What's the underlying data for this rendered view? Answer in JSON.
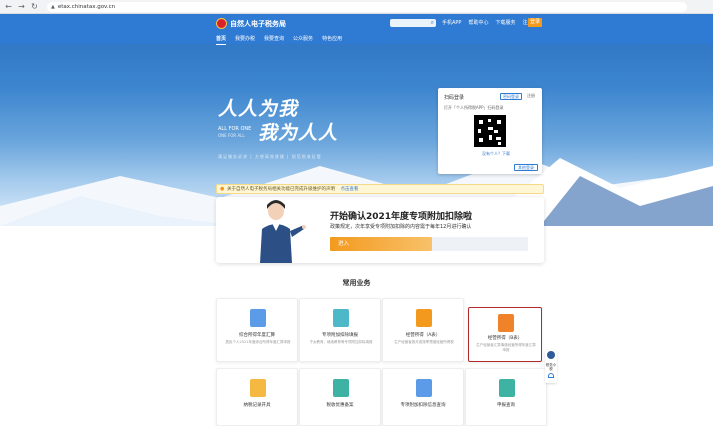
{
  "browser": {
    "url": "etax.chinatax.gov.cn"
  },
  "header": {
    "site_name": "自然人电子税务局",
    "links": [
      "手机APP",
      "帮助中心",
      "下载服务",
      "注册"
    ],
    "login_label": "登录",
    "menu": [
      "首页",
      "我要办税",
      "我要查询",
      "公众服务",
      "特色应用"
    ]
  },
  "hero": {
    "slogan1": "人人为我",
    "slogan2": "我为人人",
    "slogan_en": "ALL FOR ONE",
    "slogan_en_sub": "ONE FOR ALL",
    "tagline": "满足服务诉求 | 方便高效便捷 | 规范税收征管"
  },
  "qr_login": {
    "title": "扫码登录",
    "tab_active": "密码登录",
    "tab_other": "注册",
    "hint": "打开「个人所得税APP」扫码登录",
    "download": "没有个人？下载",
    "other_login": "其他登录"
  },
  "notice": {
    "text": "关于自然人电子税务局相关功能已完成升级维护的声明",
    "more": "点击查看"
  },
  "banner": {
    "heading": "开始确认2021年度专项附加扣除啦",
    "text": "政策规定，次年享受专项附加扣除的内容需于每年12月进行确认",
    "enter_label": "进入"
  },
  "section_title": "常用业务",
  "cards": [
    {
      "title": "综合所得年度汇算",
      "desc": "居民个人2021年度综合所得年度汇算申报",
      "icon": "tax-return-icon",
      "color": "#5b9be8"
    },
    {
      "title": "专项附加扣除填报",
      "desc": "子女教育、继续教育等专项附加扣除填报",
      "icon": "deduction-form-icon",
      "color": "#4db8c7"
    },
    {
      "title": "经营所得（A表）",
      "desc": "生产经营者按月或按季预缴经营所得税",
      "icon": "business-income-a-icon",
      "color": "#f39a1e"
    },
    {
      "title": "经营所得（B表）",
      "desc": "生产经营者汇算清缴经营所得年度汇算申报",
      "icon": "business-income-b-icon",
      "color": "#f0832a"
    }
  ],
  "cards_row2": [
    {
      "title": "纳税记录开具",
      "icon": "tax-record-icon",
      "color": "#f5b841"
    },
    {
      "title": "税收优惠备案",
      "icon": "tax-incentive-icon",
      "color": "#3fb3a3"
    },
    {
      "title": "专项附加扣除信息查询",
      "icon": "deduction-query-icon",
      "color": "#5b9be8"
    },
    {
      "title": "申报查询",
      "icon": "declaration-query-icon",
      "color": "#3fb3a3"
    }
  ],
  "side_widget": {
    "label": "税务小税"
  }
}
